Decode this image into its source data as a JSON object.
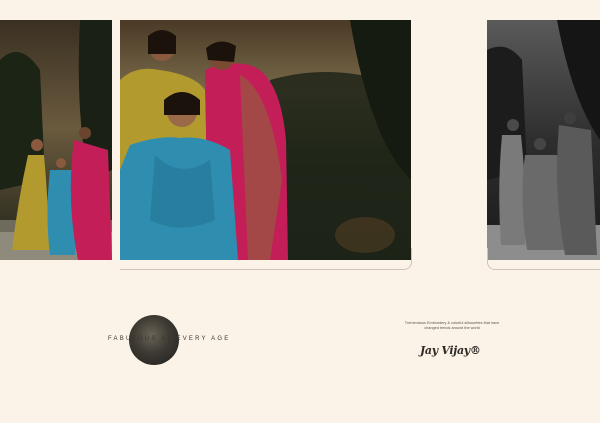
{
  "tagline": "FABULOUS AT EVERY AGE",
  "brand": {
    "description": "Tremendous Embroidery & colorful silhouettes that have changed trends around the world",
    "logo_text": "Jay Vijay®"
  },
  "colors": {
    "background": "#fbf3e7",
    "outfit_mustard": "#b29a2e",
    "outfit_teal": "#2f8db0",
    "outfit_magenta": "#c41e58",
    "painting_dark": "#1e2418"
  }
}
